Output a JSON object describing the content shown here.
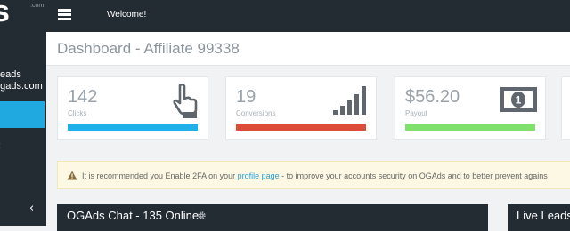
{
  "sidebar": {
    "logo_text": "s",
    "logo_sub": ".com",
    "user_line1": "eads",
    "user_line2": "ogads.com",
    "collapse_glyph": "‹"
  },
  "topbar": {
    "menu_icon": "hamburger-icon",
    "welcome": "Welcome!"
  },
  "page": {
    "title": "Dashboard - Affiliate 99338"
  },
  "stats": [
    {
      "value": "142",
      "label": "Clicks",
      "icon": "hand-pointer-icon",
      "bar_color": "#1fb0ea"
    },
    {
      "value": "19",
      "label": "Conversions",
      "icon": "signal-bars-icon",
      "bar_color": "#dd4b39"
    },
    {
      "value": "$56.20",
      "label": "Payout",
      "icon": "money-bill-icon",
      "bar_color": "#7fe06c"
    }
  ],
  "alert": {
    "icon": "warning-icon",
    "text_before": "It is recommended you Enable 2FA on your ",
    "link": "profile page",
    "text_after": " - to improve your accounts security on OGAds and to better prevent agains"
  },
  "panels": {
    "chat_title": "OGAds Chat - 135 Online",
    "chat_icon": "gear-icon",
    "leads_title": "Live Leads"
  },
  "colors": {
    "sidebar_bg": "#232b33",
    "active_item": "#1fa9e0",
    "alert_bg": "#fcf8e3",
    "link": "#2a9fd6"
  }
}
